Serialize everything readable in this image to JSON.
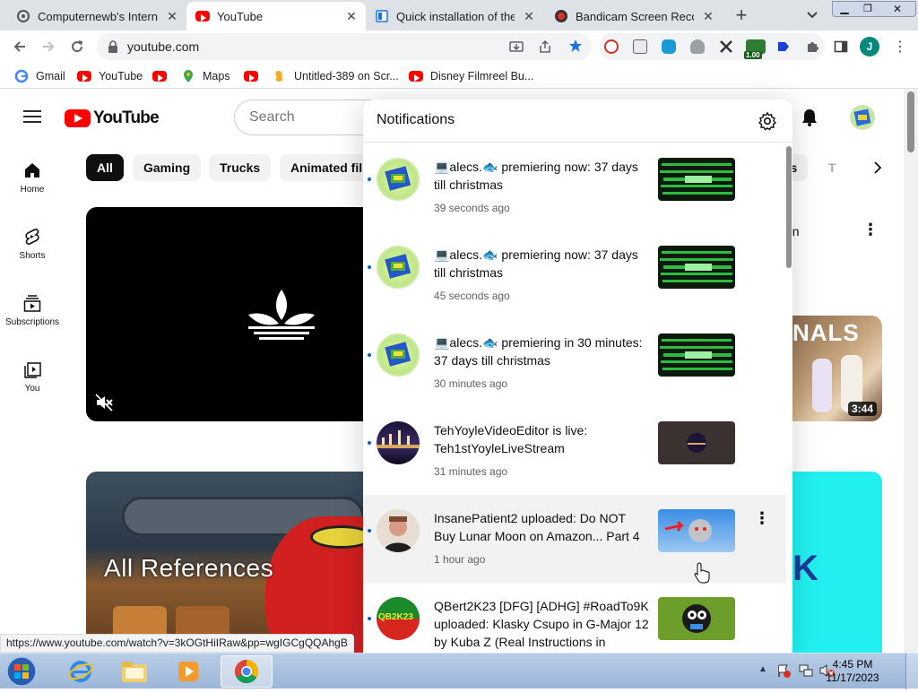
{
  "browser": {
    "tabs": [
      {
        "title": "Computernewb's Internet",
        "active": false
      },
      {
        "title": "YouTube",
        "active": true
      },
      {
        "title": "Quick installation of the",
        "active": false
      },
      {
        "title": "Bandicam Screen Recorde",
        "active": false
      }
    ],
    "new_tab": "+",
    "url": "youtube.com",
    "extension_badge": "1.00",
    "profile_initial": "J",
    "bookmarks": [
      "Gmail",
      "YouTube",
      "",
      "Maps",
      "",
      "Untitled-389 on Scr...",
      "Disney Filmreel Bu..."
    ]
  },
  "youtube": {
    "logo": "YouTube",
    "search_placeholder": "Search",
    "chips": [
      "All",
      "Gaming",
      "Trucks",
      "Animated film",
      "rs",
      "T"
    ],
    "nav": [
      "Home",
      "Shorts",
      "Subscriptions",
      "You"
    ],
    "video_partial_text": "on",
    "right_video_duration": "3:44",
    "right_video_overlay": "NALS",
    "references_title": "All References",
    "right_bottom_letter": "K"
  },
  "notifications": {
    "title": "Notifications",
    "items": [
      {
        "text": "💻alecs.🐟 premiering now: 37 days till christmas",
        "time": "39 seconds ago"
      },
      {
        "text": "💻alecs.🐟 premiering now: 37 days till christmas",
        "time": "45 seconds ago"
      },
      {
        "text": "💻alecs.🐟 premiering in 30 minutes: 37 days till christmas",
        "time": "30 minutes ago"
      },
      {
        "text": "TehYoyleVideoEditor is live: Teh1stYoyleLiveStream",
        "time": "31 minutes ago"
      },
      {
        "text": "InsanePatient2 uploaded: Do NOT Buy Lunar Moon on Amazon... Part 4",
        "time": "1 hour ago"
      },
      {
        "text": "QBert2K23 [DFG] [ADHG] #RoadTo9K uploaded: Klasky Csupo in G-Major 12 by Kuba Z (Real Instructions in",
        "time": ""
      }
    ],
    "avatar_text_qbert": "QB2K23"
  },
  "status_url": "https://www.youtube.com/watch?v=3kOGtHiIRaw&pp=wgIGCgQQAhgB",
  "taskbar": {
    "time": "4:45 PM",
    "date": "11/17/2023"
  }
}
